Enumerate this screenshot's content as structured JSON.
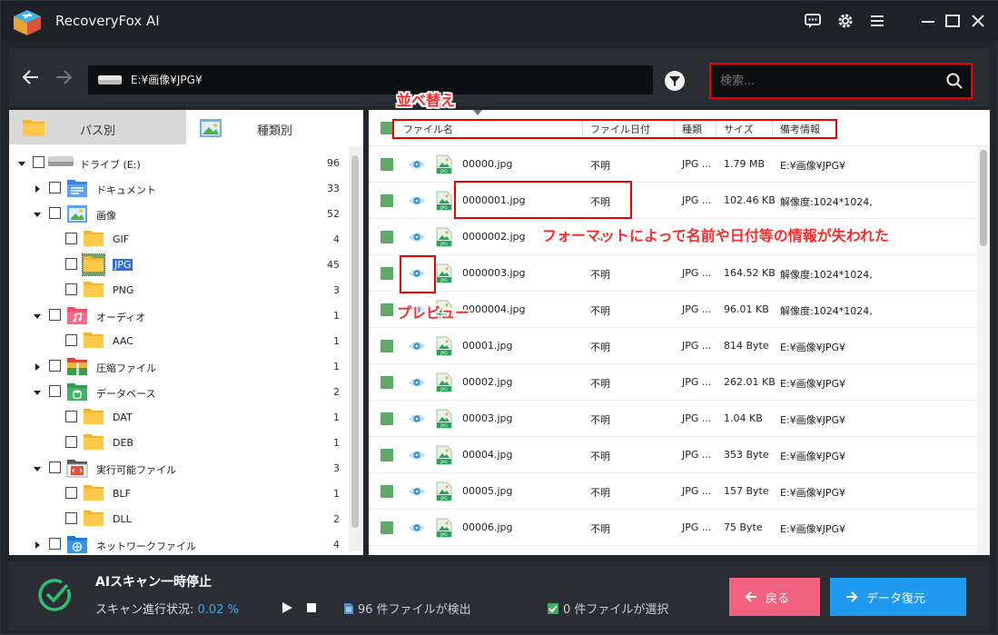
{
  "app": {
    "title": "RecoveryFox AI"
  },
  "nav": {
    "path": "E:¥画像¥JPG¥",
    "search_placeholder": "検索..."
  },
  "tabs": [
    {
      "label": "パス別"
    },
    {
      "label": "種類別"
    }
  ],
  "tree": [
    {
      "label": "ドライブ (E:)",
      "count": "96",
      "level": 0,
      "icon": "drive-icon",
      "arrow": "down"
    },
    {
      "label": "ドキュメント",
      "count": "33",
      "level": 1,
      "icon": "document-folder-icon",
      "arrow": "right"
    },
    {
      "label": "画像",
      "count": "52",
      "level": 1,
      "icon": "image-folder-icon",
      "arrow": "down"
    },
    {
      "label": "GIF",
      "count": "4",
      "level": 2,
      "icon": "folder-icon"
    },
    {
      "label": "JPG",
      "count": "45",
      "level": 2,
      "icon": "folder-icon",
      "selected": true
    },
    {
      "label": "PNG",
      "count": "3",
      "level": 2,
      "icon": "folder-icon"
    },
    {
      "label": "オーディオ",
      "count": "1",
      "level": 1,
      "icon": "audio-folder-icon",
      "arrow": "down"
    },
    {
      "label": "AAC",
      "count": "1",
      "level": 2,
      "icon": "folder-icon"
    },
    {
      "label": "圧縮ファイル",
      "count": "1",
      "level": 1,
      "icon": "archive-folder-icon",
      "arrow": "right"
    },
    {
      "label": "データベース",
      "count": "2",
      "level": 1,
      "icon": "database-folder-icon",
      "arrow": "down"
    },
    {
      "label": "DAT",
      "count": "1",
      "level": 2,
      "icon": "folder-icon"
    },
    {
      "label": "DEB",
      "count": "1",
      "level": 2,
      "icon": "folder-icon"
    },
    {
      "label": "実行可能ファイル",
      "count": "3",
      "level": 1,
      "icon": "executable-folder-icon",
      "arrow": "down"
    },
    {
      "label": "BLF",
      "count": "1",
      "level": 2,
      "icon": "folder-icon"
    },
    {
      "label": "DLL",
      "count": "2",
      "level": 2,
      "icon": "folder-icon"
    },
    {
      "label": "ネットワークファイル",
      "count": "4",
      "level": 1,
      "icon": "network-folder-icon",
      "arrow": "right"
    }
  ],
  "columns": {
    "name": "ファイル名",
    "date": "ファイル日付",
    "type": "種類",
    "size": "サイズ",
    "notes": "備考情報"
  },
  "files": [
    {
      "name": "00000.jpg",
      "date": "不明",
      "type": "JPG ...",
      "size": "1.79 MB",
      "notes": "E:¥画像¥JPG¥"
    },
    {
      "name": "0000001.jpg",
      "date": "不明",
      "type": "JPG ...",
      "size": "102.46 KB",
      "notes": "解像度:1024*1024,"
    },
    {
      "name": "0000002.jpg",
      "date": "不明",
      "type": "JPG ...",
      "size": "",
      "notes": ""
    },
    {
      "name": "0000003.jpg",
      "date": "不明",
      "type": "JPG ...",
      "size": "164.52 KB",
      "notes": "解像度:1024*1024,"
    },
    {
      "name": "0000004.jpg",
      "date": "不明",
      "type": "JPG ...",
      "size": "96.01 KB",
      "notes": "解像度:1024*1024,"
    },
    {
      "name": "00001.jpg",
      "date": "不明",
      "type": "JPG ...",
      "size": "814 Byte",
      "notes": "E:¥画像¥JPG¥"
    },
    {
      "name": "00002.jpg",
      "date": "不明",
      "type": "JPG ...",
      "size": "262.01 KB",
      "notes": "E:¥画像¥JPG¥"
    },
    {
      "name": "00003.jpg",
      "date": "不明",
      "type": "JPG ...",
      "size": "1.04 KB",
      "notes": "E:¥画像¥JPG¥"
    },
    {
      "name": "00004.jpg",
      "date": "不明",
      "type": "JPG ...",
      "size": "353 Byte",
      "notes": "E:¥画像¥JPG¥"
    },
    {
      "name": "00005.jpg",
      "date": "不明",
      "type": "JPG ...",
      "size": "157 Byte",
      "notes": "E:¥画像¥JPG¥"
    },
    {
      "name": "00006.jpg",
      "date": "不明",
      "type": "JPG ...",
      "size": "75 Byte",
      "notes": "E:¥画像¥JPG¥"
    }
  ],
  "annotations": {
    "sort": "並べ替え",
    "lost_info": "フォーマットによって名前や日付等の情報が失われた",
    "preview": "プレビュー"
  },
  "status": {
    "title": "AIスキャン一時停止",
    "progress_label": "スキャン進行状況:",
    "progress_value": "0.02 %",
    "found": "96 件ファイルが検出",
    "selected": "0 件ファイルが選択"
  },
  "buttons": {
    "back": "戻る",
    "recover": "データ復元"
  },
  "colors": {
    "accent": "#1e9bf0",
    "back": "#f06280",
    "check": "#5faa68",
    "highlight": "#ee0000"
  }
}
